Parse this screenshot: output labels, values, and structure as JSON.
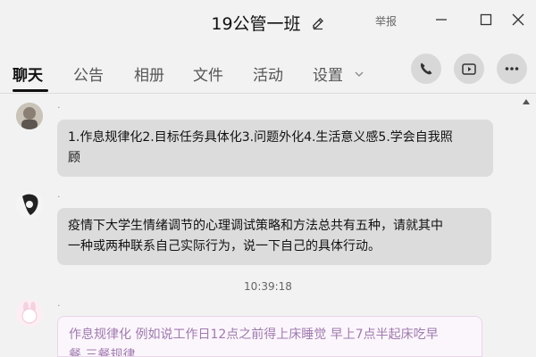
{
  "window": {
    "title": "19公管一班",
    "report_label": "举报"
  },
  "tabs": [
    {
      "label": "聊天",
      "active": true
    },
    {
      "label": "公告",
      "active": false
    },
    {
      "label": "相册",
      "active": false
    },
    {
      "label": "文件",
      "active": false
    },
    {
      "label": "活动",
      "active": false
    },
    {
      "label": "设置",
      "active": false
    }
  ],
  "icons": {
    "edit": "pencil-icon",
    "minimize": "minimize-icon",
    "maximize": "maximize-icon",
    "close": "close-icon",
    "call": "phone-icon",
    "video": "video-camera-icon",
    "more": "more-icon",
    "dropdown": "chevron-down-icon"
  },
  "messages": [
    {
      "text_line1": "1.作息规律化2.目标任务具体化3.问题外化4.生活意义感5.学会自我照",
      "text_line2": "顾"
    },
    {
      "text_line1": "疫情下大学生情绪调节的心理调试策略和方法总共有五种，请就其中",
      "text_line2": "一种或两种联系自己实际行为，说一下自己的具体行动。"
    }
  ],
  "timestamp": "10:39:18",
  "my_message": {
    "text_line1": "作息规律化 例如说工作日12点之前得上床睡觉 早上7点半起床吃早",
    "text_line2": "餐 三餐规律"
  },
  "colors": {
    "background": "#f2f2f2",
    "bubble": "#dcdcdc",
    "my_bubble_text": "#a07ab0",
    "active_tab": "#111111"
  }
}
